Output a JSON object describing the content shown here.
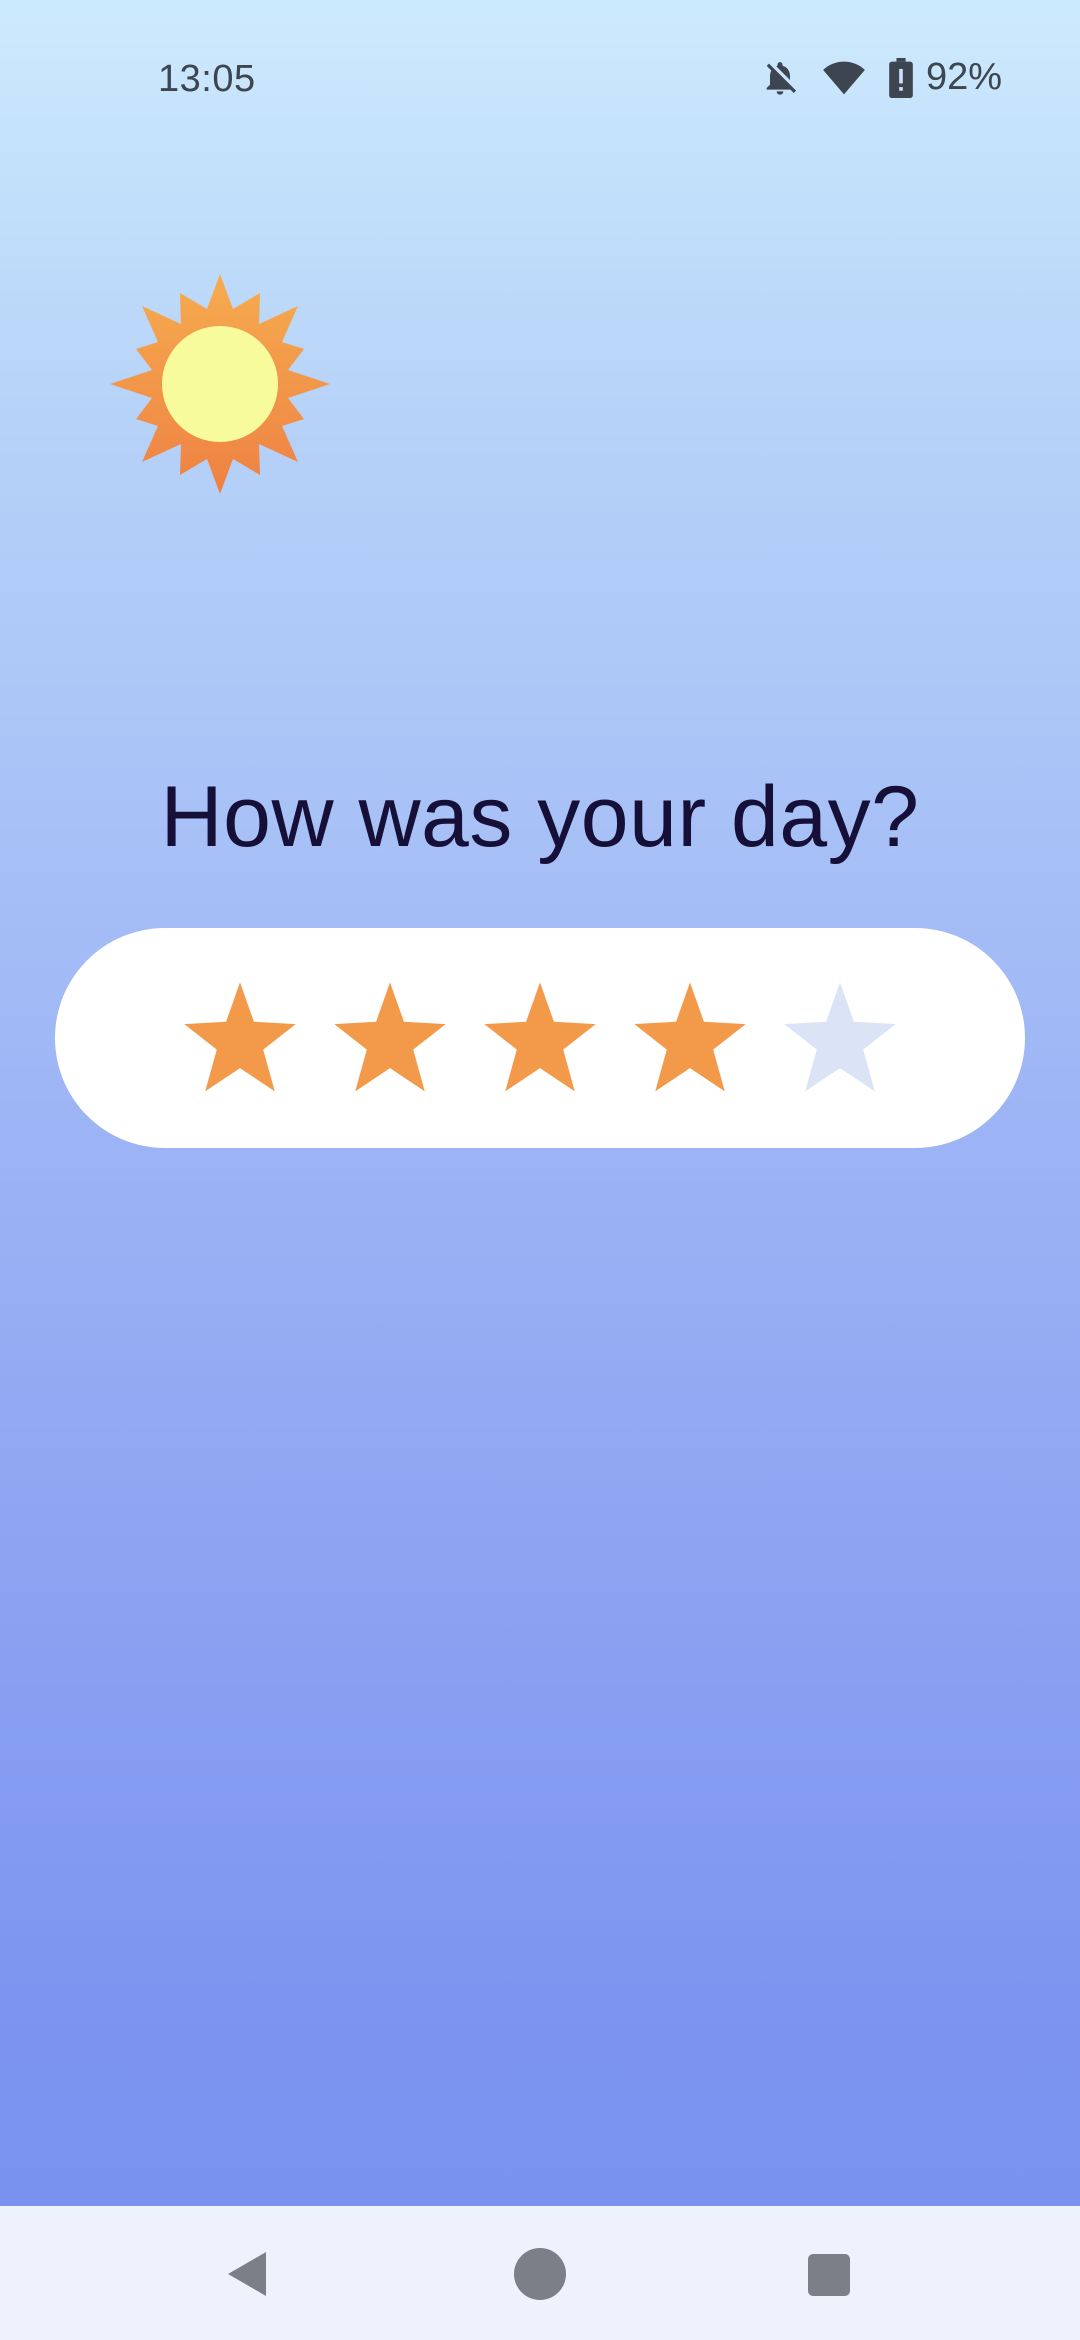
{
  "status_bar": {
    "time": "13:05",
    "battery_percent": "92%",
    "icons": [
      "notifications-off-icon",
      "wifi-icon",
      "battery-alert-icon"
    ]
  },
  "header": {
    "sun_icon": "sun-icon"
  },
  "main": {
    "question": "How was your day?",
    "rating": {
      "value": 4,
      "max": 5
    }
  },
  "colors": {
    "star_filled": "#f39a4a",
    "star_empty": "#dbe3f6",
    "question_text": "#161038"
  },
  "nav_bar": {
    "buttons": [
      "back-icon",
      "home-icon",
      "recents-icon"
    ]
  }
}
